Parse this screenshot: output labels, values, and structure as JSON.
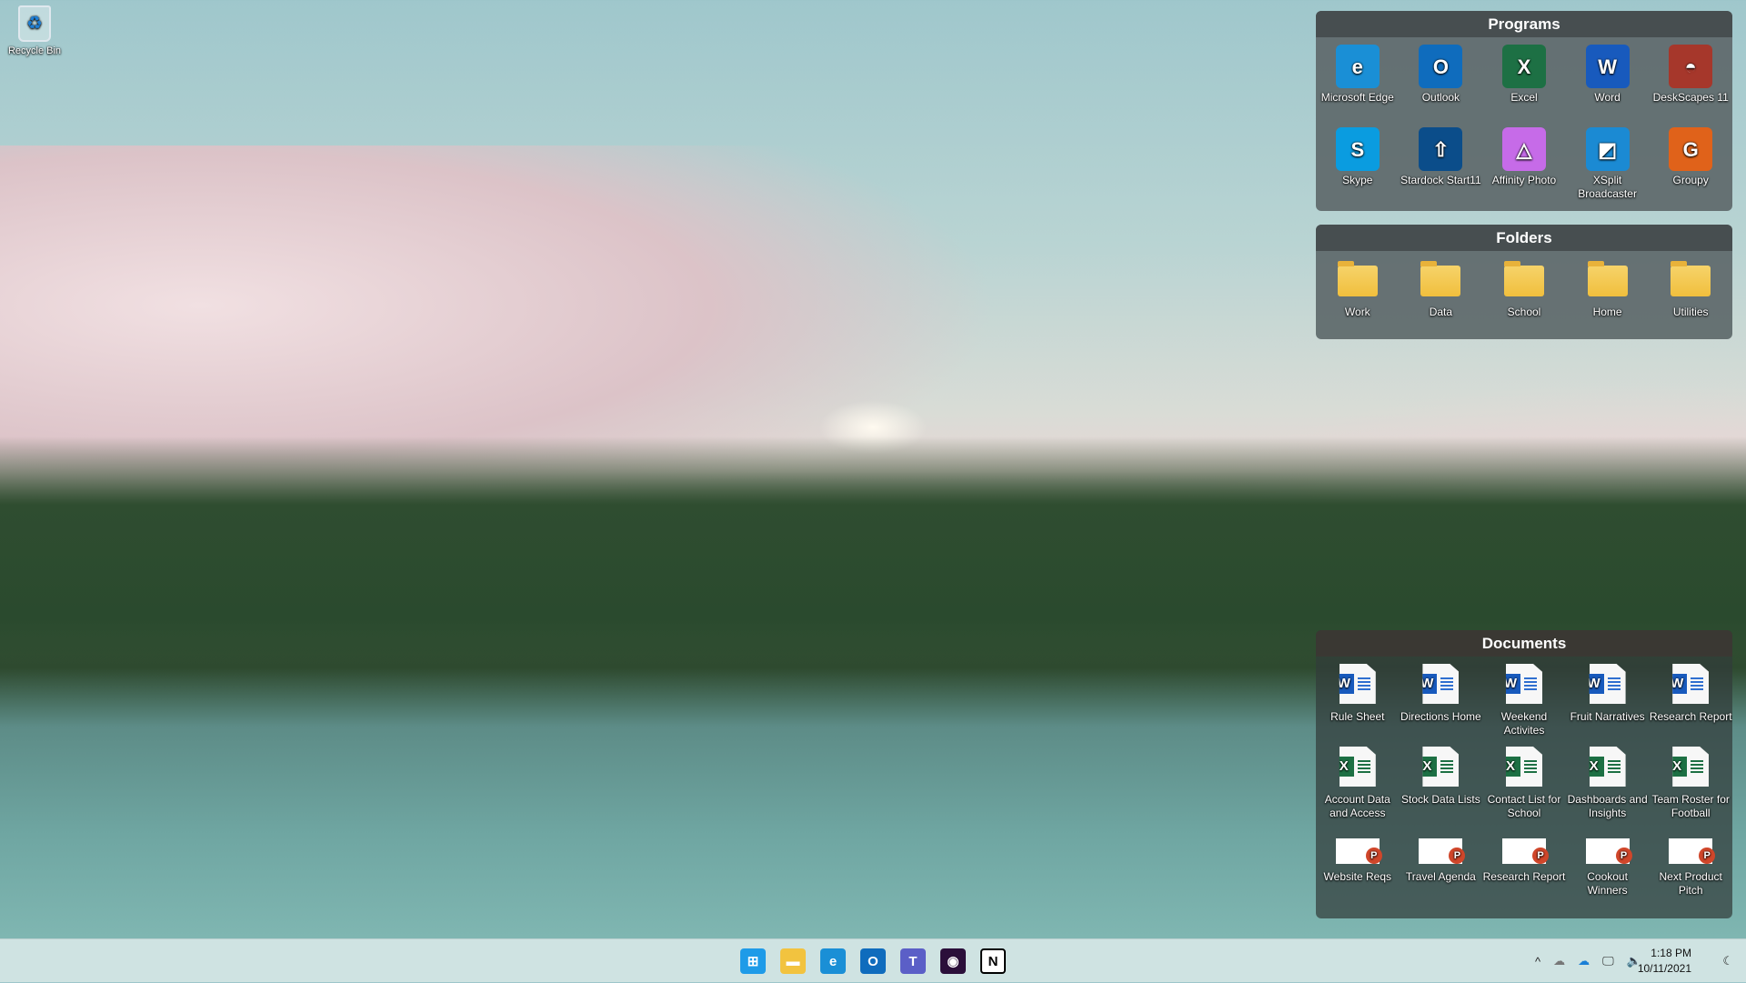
{
  "desktop": {
    "recycle_bin": "Recycle Bin"
  },
  "programs": {
    "title": "Programs",
    "items": [
      {
        "label": "Microsoft Edge",
        "icon": "edge-icon",
        "color": "#1a8fd6",
        "glyph": "e"
      },
      {
        "label": "Outlook",
        "icon": "outlook-icon",
        "color": "#0f6cbd",
        "glyph": "O"
      },
      {
        "label": "Excel",
        "icon": "excel-icon",
        "color": "#1d7044",
        "glyph": "X"
      },
      {
        "label": "Word",
        "icon": "word-icon",
        "color": "#185abd",
        "glyph": "W"
      },
      {
        "label": "DeskScapes 11",
        "icon": "deskscapes-icon",
        "color": "#a6372b",
        "glyph": "◓"
      },
      {
        "label": "Skype",
        "icon": "skype-icon",
        "color": "#0a9ce0",
        "glyph": "S"
      },
      {
        "label": "Stardock Start11",
        "icon": "start11-icon",
        "color": "#0b4d8a",
        "glyph": "⇧"
      },
      {
        "label": "Affinity Photo",
        "icon": "affinity-photo-icon",
        "color": "#c66be8",
        "glyph": "△"
      },
      {
        "label": "XSplit Broadcaster",
        "icon": "xsplit-icon",
        "color": "#1b8ad3",
        "glyph": "◩"
      },
      {
        "label": "Groupy",
        "icon": "groupy-icon",
        "color": "#e0621a",
        "glyph": "G"
      }
    ]
  },
  "folders": {
    "title": "Folders",
    "items": [
      "Work",
      "Data",
      "School",
      "Home",
      "Utilities"
    ]
  },
  "documents": {
    "title": "Documents",
    "items": [
      {
        "label": "Rule Sheet",
        "type": "word"
      },
      {
        "label": "Directions Home",
        "type": "word"
      },
      {
        "label": "Weekend Activites",
        "type": "word"
      },
      {
        "label": "Fruit Narratives",
        "type": "word"
      },
      {
        "label": "Research Report",
        "type": "word"
      },
      {
        "label": "Account Data and Access",
        "type": "excel"
      },
      {
        "label": "Stock Data Lists",
        "type": "excel"
      },
      {
        "label": "Contact List for School",
        "type": "excel"
      },
      {
        "label": "Dashboards and Insights",
        "type": "excel"
      },
      {
        "label": "Team Roster for Football",
        "type": "excel"
      },
      {
        "label": "Website Reqs",
        "type": "powerpoint"
      },
      {
        "label": "Travel Agenda",
        "type": "powerpoint"
      },
      {
        "label": "Research Report",
        "type": "powerpoint"
      },
      {
        "label": "Cookout Winners",
        "type": "powerpoint"
      },
      {
        "label": "Next Product Pitch",
        "type": "powerpoint"
      }
    ]
  },
  "taskbar": {
    "apps": [
      {
        "name": "start-icon",
        "color": "#1e9be8",
        "glyph": "⊞"
      },
      {
        "name": "file-explorer-icon",
        "color": "#f2c33f",
        "glyph": "▬"
      },
      {
        "name": "edge-icon",
        "color": "#1a8fd6",
        "glyph": "e"
      },
      {
        "name": "outlook-icon",
        "color": "#0f6cbd",
        "glyph": "O"
      },
      {
        "name": "teams-icon",
        "color": "#5b5fc7",
        "glyph": "T"
      },
      {
        "name": "premiere-rush-icon",
        "color": "#2b0f3a",
        "glyph": "◉"
      },
      {
        "name": "notion-icon",
        "color": "#ffffff",
        "glyph": "N"
      }
    ],
    "tray": {
      "time": "1:18 PM",
      "date": "10/11/2021"
    }
  },
  "colors": {
    "word": "#185abd",
    "excel": "#1d7044",
    "powerpoint": "#d0462a"
  }
}
